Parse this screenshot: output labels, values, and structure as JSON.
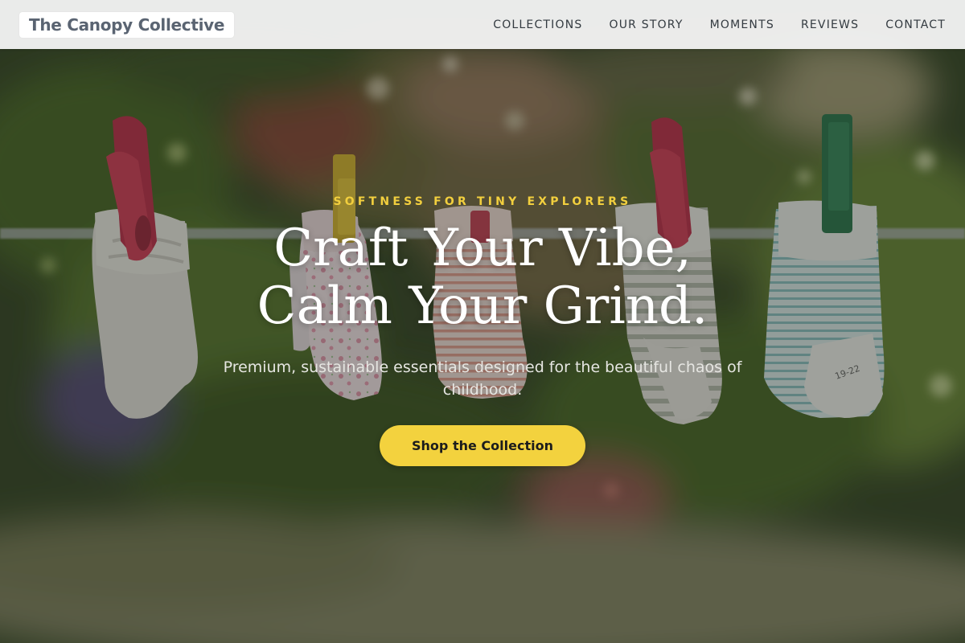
{
  "nav": {
    "logo": "The Canopy Collective",
    "links": [
      {
        "label": "COLLECTIONS"
      },
      {
        "label": "OUR STORY"
      },
      {
        "label": "MOMENTS"
      },
      {
        "label": "REVIEWS"
      },
      {
        "label": "CONTACT"
      }
    ]
  },
  "hero": {
    "eyebrow": "SOFTNESS FOR TINY EXPLORERS",
    "headline_line1": "Craft Your Vibe,",
    "headline_line2": "Calm Your Grind.",
    "subtext": "Premium, sustainable essentials designed for the beautiful chaos of childhood.",
    "cta_label": "Shop the Collection",
    "sock_size_print": "19-22"
  },
  "colors": {
    "accent": "#f3d23e",
    "eyebrow": "#f2cf3e",
    "nav_bg": "#f3f3f3",
    "logo_text": "#5a6472"
  }
}
